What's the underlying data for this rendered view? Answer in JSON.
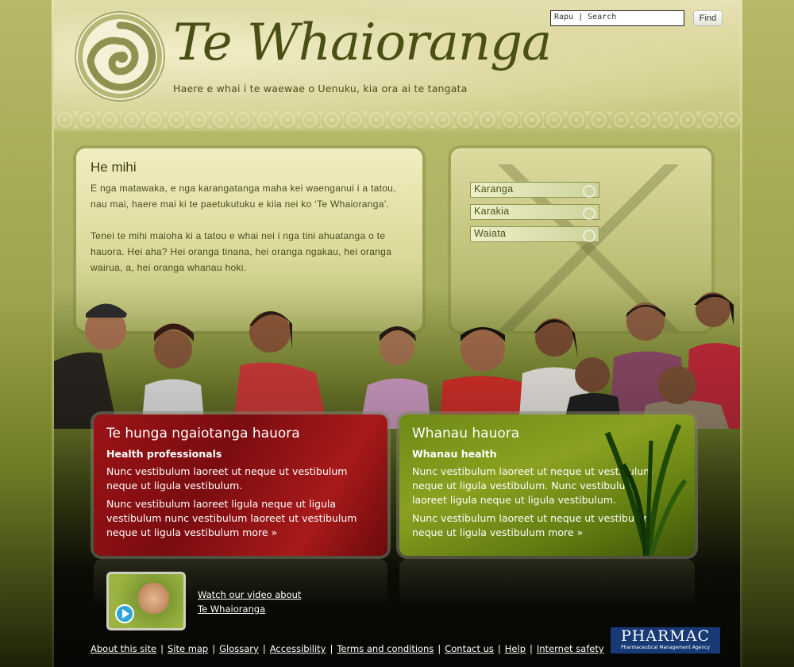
{
  "header": {
    "title": "Te Whaioranga",
    "tagline": "Haere e whai i te waewae o Uenuku, kia ora ai te tangata",
    "search_value": "Rapu | Search",
    "find_label": "Find"
  },
  "intro": {
    "heading": "He mihi",
    "paragraphs": [
      "E nga matawaka, e nga  karangatanga maha kei waenganui i a tatou, nau mai, haere mai ki te paetukutuku e kiia nei ko ‘Te Whaioranga’.",
      "Tenei te mihi maioha ki a tatou e whai nei i nga tini ahuatanga o te hauora. Hei aha? Hei oranga tinana, hei oranga ngakau, hei oranga wairua, a, hei oranga whanau hoki."
    ]
  },
  "menu": {
    "items": [
      {
        "label": "Karanga"
      },
      {
        "label": "Karakia"
      },
      {
        "label": "Waiata"
      }
    ]
  },
  "features": {
    "health_professionals": {
      "heading": "Te hunga ngaiotanga hauora",
      "subheading": "Health professionals",
      "p1": "Nunc vestibulum laoreet ut neque ut vestibulum neque ut ligula vestibulum.",
      "p2": "Nunc vestibulum laoreet ligula neque ut ligula vestibulum nunc vestibulum laoreet ut vestibulum neque ut ligula vestibulum",
      "more": "more »"
    },
    "whanau_health": {
      "heading": "Whanau hauora",
      "subheading": "Whanau health",
      "p1": "Nunc vestibulum laoreet ut neque ut vestibulum neque ut ligula vestibulum. Nunc vestibulum laoreet ligula neque ut ligula vestibulum.",
      "p2": "Nunc vestibulum laoreet ut neque ut vestibulum neque ut ligula vestibulum",
      "more": "more »"
    }
  },
  "video": {
    "line1": "Watch our video about",
    "line2": "Te Whaioranga"
  },
  "footer": {
    "links": [
      "About this site",
      "Site map",
      "Glossary",
      "Accessibility",
      "Terms and conditions",
      "Contact us",
      "Help",
      "Internet safety"
    ],
    "separator": "|",
    "pharmac_name": "PHARMAC",
    "pharmac_sub": "Pharmaceutical Management Agency"
  },
  "colors": {
    "red_panel": "#9c1416",
    "green_panel": "#6e8a16",
    "pharmac_blue": "#173a76",
    "title_olive": "#4a4f14"
  }
}
